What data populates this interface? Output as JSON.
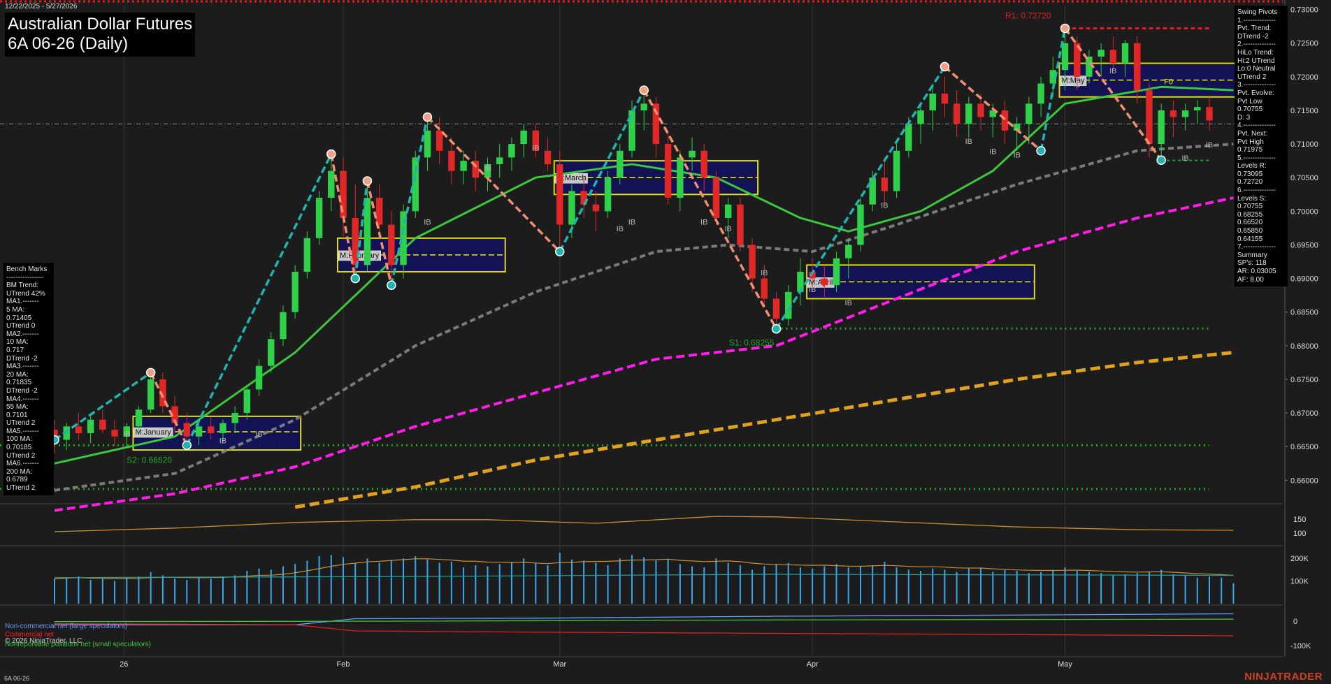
{
  "header": {
    "date_range": "12/22/2025 - 5/27/2026",
    "title": "Australian Dollar Futures",
    "subtitle": "6A 06-26 (Daily)"
  },
  "swing_panel": {
    "lines": [
      "Swing Pivots",
      "1.--------------",
      "Pvt. Trend:",
      "DTrend -2",
      "2.--------------",
      "HiLo Trend:",
      "Hi:2 UTrend",
      "Lo:0 Neutral",
      "UTrend 2",
      "3.--------------",
      "Pvt. Evolve:",
      "Pvt Low",
      "0.70755",
      "D: 3",
      "4.--------------",
      "Pvt. Next:",
      "Pvt High",
      "0.71975",
      "5.--------------",
      "Levels R:",
      "0.73095",
      "0.72720",
      "6.--------------",
      "Levels S:",
      "0.70755",
      "0.68255",
      "0.66520",
      "0.65850",
      "0.64155",
      "7.--------------",
      "Summary",
      "SP's: 118",
      "AR: 0.03005",
      "AF: 8.00"
    ]
  },
  "bench_panel": {
    "lines": [
      "Bench Marks",
      "----------------",
      "BM Trend:",
      "UTrend 42%",
      "MA1.-------",
      "5 MA:",
      "0.71405",
      "UTrend 0",
      "MA2.-------",
      "10 MA:",
      "0.717",
      "DTrend -2",
      "MA3.-------",
      "20 MA:",
      "0.71835",
      "DTrend -2",
      "MA4.-------",
      "55 MA:",
      "0.7101",
      "UTrend 2",
      "MA5.-------",
      "100 MA:",
      "0.70185",
      "UTrend 2",
      "MA6.-------",
      "200 MA:",
      "0.6789",
      "UTrend 2"
    ]
  },
  "labels": {
    "r1": "R1: 0.72720",
    "s1": "S1: 0.68255",
    "s2": "S2: 0.66520",
    "f0": "F0",
    "ib": "IB"
  },
  "months": {
    "january": "M:January",
    "february": "M:February",
    "march": "M:March",
    "april": "M:April",
    "may": "M:May"
  },
  "cot_legend": {
    "noncommercial": "Non-commercial net (large speculators)",
    "commercial": "Commercial net",
    "copyright": "© 2026 NinjaTrader, LLC",
    "nonreportable": "Nonreportable positions net (small speculators)"
  },
  "footer": {
    "instrument": "6A 06-26",
    "brand": "NINJATRADER"
  },
  "colors": {
    "background": "#1c1c1c",
    "up_candle": "#2fd04a",
    "down_candle": "#e02828",
    "swing_up": "#20b4b0",
    "swing_down": "#f09070",
    "ma_green": "#3cc83c",
    "ma_gray": "#7a7a7a",
    "ma_magenta": "#ff1ee6",
    "ma_orange": "#e0a020",
    "month_box": "#12125a",
    "month_border": "#f0f000",
    "volume": "#3aa8f0"
  },
  "chart_data": {
    "type": "candlestick",
    "title": "Australian Dollar Futures 6A 06-26 (Daily)",
    "price_axis": {
      "ylim": [
        0.6565,
        0.731
      ],
      "ticks": [
        0.66,
        0.665,
        0.67,
        0.675,
        0.68,
        0.685,
        0.69,
        0.695,
        0.7,
        0.705,
        0.71,
        0.715,
        0.72,
        0.725,
        0.73
      ]
    },
    "x_ticks": [
      {
        "label": "26",
        "i": 6
      },
      {
        "label": "Feb",
        "i": 24
      },
      {
        "label": "Mar",
        "i": 42
      },
      {
        "label": "Apr",
        "i": 63
      },
      {
        "label": "May",
        "i": 84
      }
    ],
    "candles": [
      [
        0.6675,
        0.669,
        0.664,
        0.666
      ],
      [
        0.666,
        0.6685,
        0.6645,
        0.668
      ],
      [
        0.668,
        0.67,
        0.666,
        0.667
      ],
      [
        0.667,
        0.6695,
        0.6655,
        0.669
      ],
      [
        0.669,
        0.6705,
        0.667,
        0.6675
      ],
      [
        0.6675,
        0.669,
        0.665,
        0.6665
      ],
      [
        0.6665,
        0.6685,
        0.665,
        0.668
      ],
      [
        0.668,
        0.671,
        0.667,
        0.6705
      ],
      [
        0.6705,
        0.676,
        0.67,
        0.675
      ],
      [
        0.675,
        0.676,
        0.67,
        0.671
      ],
      [
        0.671,
        0.6725,
        0.667,
        0.6685
      ],
      [
        0.6685,
        0.67,
        0.6655,
        0.6665
      ],
      [
        0.6665,
        0.669,
        0.6652,
        0.668
      ],
      [
        0.668,
        0.6695,
        0.666,
        0.667
      ],
      [
        0.667,
        0.669,
        0.6655,
        0.6685
      ],
      [
        0.6685,
        0.671,
        0.667,
        0.67
      ],
      [
        0.67,
        0.674,
        0.669,
        0.6735
      ],
      [
        0.6735,
        0.678,
        0.6725,
        0.677
      ],
      [
        0.677,
        0.682,
        0.676,
        0.681
      ],
      [
        0.681,
        0.686,
        0.68,
        0.685
      ],
      [
        0.685,
        0.692,
        0.684,
        0.691
      ],
      [
        0.691,
        0.697,
        0.69,
        0.696
      ],
      [
        0.696,
        0.703,
        0.695,
        0.702
      ],
      [
        0.702,
        0.7085,
        0.7,
        0.706
      ],
      [
        0.706,
        0.708,
        0.696,
        0.699
      ],
      [
        0.699,
        0.704,
        0.69,
        0.692
      ],
      [
        0.692,
        0.7045,
        0.691,
        0.702
      ],
      [
        0.702,
        0.704,
        0.696,
        0.698
      ],
      [
        0.698,
        0.7,
        0.689,
        0.692
      ],
      [
        0.692,
        0.701,
        0.69,
        0.7
      ],
      [
        0.7,
        0.709,
        0.699,
        0.708
      ],
      [
        0.708,
        0.7135,
        0.706,
        0.712
      ],
      [
        0.712,
        0.714,
        0.707,
        0.709
      ],
      [
        0.709,
        0.711,
        0.704,
        0.706
      ],
      [
        0.706,
        0.709,
        0.704,
        0.7075
      ],
      [
        0.7075,
        0.709,
        0.703,
        0.705
      ],
      [
        0.705,
        0.708,
        0.703,
        0.707
      ],
      [
        0.707,
        0.71,
        0.705,
        0.708
      ],
      [
        0.708,
        0.711,
        0.706,
        0.71
      ],
      [
        0.71,
        0.713,
        0.708,
        0.712
      ],
      [
        0.712,
        0.713,
        0.708,
        0.709
      ],
      [
        0.709,
        0.711,
        0.706,
        0.707
      ],
      [
        0.707,
        0.709,
        0.694,
        0.698
      ],
      [
        0.698,
        0.704,
        0.696,
        0.703
      ],
      [
        0.703,
        0.705,
        0.699,
        0.701
      ],
      [
        0.701,
        0.703,
        0.697,
        0.7
      ],
      [
        0.7,
        0.706,
        0.699,
        0.705
      ],
      [
        0.705,
        0.71,
        0.704,
        0.709
      ],
      [
        0.709,
        0.7165,
        0.708,
        0.715
      ],
      [
        0.715,
        0.718,
        0.712,
        0.716
      ],
      [
        0.716,
        0.717,
        0.708,
        0.71
      ],
      [
        0.71,
        0.712,
        0.701,
        0.702
      ],
      [
        0.702,
        0.709,
        0.7,
        0.708
      ],
      [
        0.708,
        0.711,
        0.706,
        0.709
      ],
      [
        0.709,
        0.71,
        0.703,
        0.705
      ],
      [
        0.705,
        0.706,
        0.698,
        0.699
      ],
      [
        0.699,
        0.702,
        0.696,
        0.701
      ],
      [
        0.701,
        0.702,
        0.694,
        0.695
      ],
      [
        0.695,
        0.696,
        0.688,
        0.69
      ],
      [
        0.69,
        0.692,
        0.686,
        0.687
      ],
      [
        0.687,
        0.688,
        0.6825,
        0.684
      ],
      [
        0.684,
        0.689,
        0.683,
        0.688
      ],
      [
        0.688,
        0.693,
        0.686,
        0.691
      ],
      [
        0.691,
        0.693,
        0.688,
        0.69
      ],
      [
        0.69,
        0.692,
        0.687,
        0.689
      ],
      [
        0.689,
        0.694,
        0.688,
        0.693
      ],
      [
        0.693,
        0.696,
        0.69,
        0.695
      ],
      [
        0.695,
        0.702,
        0.694,
        0.701
      ],
      [
        0.701,
        0.706,
        0.7,
        0.705
      ],
      [
        0.705,
        0.708,
        0.701,
        0.703
      ],
      [
        0.703,
        0.71,
        0.702,
        0.709
      ],
      [
        0.709,
        0.714,
        0.708,
        0.713
      ],
      [
        0.713,
        0.716,
        0.71,
        0.715
      ],
      [
        0.715,
        0.719,
        0.712,
        0.7175
      ],
      [
        0.7175,
        0.72,
        0.714,
        0.716
      ],
      [
        0.716,
        0.718,
        0.711,
        0.713
      ],
      [
        0.713,
        0.717,
        0.711,
        0.716
      ],
      [
        0.716,
        0.7175,
        0.712,
        0.714
      ],
      [
        0.714,
        0.716,
        0.711,
        0.715
      ],
      [
        0.715,
        0.7165,
        0.71,
        0.712
      ],
      [
        0.712,
        0.714,
        0.709,
        0.713
      ],
      [
        0.713,
        0.717,
        0.71,
        0.716
      ],
      [
        0.716,
        0.72,
        0.714,
        0.719
      ],
      [
        0.719,
        0.723,
        0.717,
        0.721
      ],
      [
        0.721,
        0.7272,
        0.718,
        0.725
      ],
      [
        0.725,
        0.726,
        0.718,
        0.72
      ],
      [
        0.72,
        0.724,
        0.719,
        0.723
      ],
      [
        0.723,
        0.725,
        0.72,
        0.724
      ],
      [
        0.724,
        0.726,
        0.721,
        0.722
      ],
      [
        0.722,
        0.7255,
        0.72,
        0.725
      ],
      [
        0.725,
        0.726,
        0.716,
        0.718
      ],
      [
        0.718,
        0.719,
        0.708,
        0.71
      ],
      [
        0.71,
        0.716,
        0.7076,
        0.715
      ],
      [
        0.715,
        0.7165,
        0.711,
        0.714
      ],
      [
        0.714,
        0.716,
        0.712,
        0.715
      ],
      [
        0.715,
        0.7165,
        0.713,
        0.7155
      ],
      [
        0.7155,
        0.717,
        0.712,
        0.7135
      ]
    ],
    "swing_pivots": [
      {
        "i": 0,
        "price": 0.666
      },
      {
        "i": 8,
        "price": 0.676
      },
      {
        "i": 11,
        "price": 0.6652
      },
      {
        "i": 23,
        "price": 0.7085
      },
      {
        "i": 25,
        "price": 0.69
      },
      {
        "i": 26,
        "price": 0.7045
      },
      {
        "i": 28,
        "price": 0.689
      },
      {
        "i": 31,
        "price": 0.714
      },
      {
        "i": 42,
        "price": 0.694
      },
      {
        "i": 49,
        "price": 0.718
      },
      {
        "i": 60,
        "price": 0.6825
      },
      {
        "i": 74,
        "price": 0.7215
      },
      {
        "i": 82,
        "price": 0.709
      },
      {
        "i": 84,
        "price": 0.7272
      },
      {
        "i": 92,
        "price": 0.7076
      }
    ],
    "levels": [
      {
        "name": "R1",
        "price": 0.7272
      },
      {
        "name": "S1",
        "price": 0.68255
      },
      {
        "name": "S2",
        "price": 0.6652
      },
      {
        "name": "S",
        "price": 0.6587
      },
      {
        "name": "Pvt Low",
        "price": 0.70755
      }
    ],
    "current_price_line": 0.713,
    "month_boxes": [
      {
        "label": "M:January",
        "i0": 7,
        "i1": 20,
        "top": 0.6695,
        "bottom": 0.6645,
        "mid": 0.6672
      },
      {
        "label": "M:February",
        "i0": 24,
        "i1": 37,
        "top": 0.696,
        "bottom": 0.691,
        "mid": 0.6935
      },
      {
        "label": "M:March",
        "i0": 42,
        "i1": 58,
        "top": 0.7075,
        "bottom": 0.7025,
        "mid": 0.705
      },
      {
        "label": "M:April",
        "i0": 63,
        "i1": 81,
        "top": 0.692,
        "bottom": 0.687,
        "mid": 0.6895
      },
      {
        "label": "M:May",
        "i0": 84,
        "i1": 98,
        "top": 0.722,
        "bottom": 0.717,
        "mid": 0.7195
      }
    ],
    "moving_averages": [
      {
        "name": "20 MA",
        "color": "green",
        "points": [
          [
            0,
            0.6625
          ],
          [
            10,
            0.6665
          ],
          [
            20,
            0.679
          ],
          [
            30,
            0.696
          ],
          [
            40,
            0.705
          ],
          [
            48,
            0.707
          ],
          [
            55,
            0.705
          ],
          [
            62,
            0.699
          ],
          [
            66,
            0.697
          ],
          [
            72,
            0.7
          ],
          [
            78,
            0.706
          ],
          [
            84,
            0.716
          ],
          [
            92,
            0.7185
          ],
          [
            98,
            0.718
          ]
        ]
      },
      {
        "name": "55 MA",
        "color": "gray",
        "points": [
          [
            0,
            0.6585
          ],
          [
            10,
            0.661
          ],
          [
            20,
            0.669
          ],
          [
            30,
            0.68
          ],
          [
            40,
            0.688
          ],
          [
            50,
            0.694
          ],
          [
            56,
            0.695
          ],
          [
            63,
            0.694
          ],
          [
            70,
            0.698
          ],
          [
            80,
            0.704
          ],
          [
            90,
            0.709
          ],
          [
            98,
            0.71
          ]
        ]
      },
      {
        "name": "100 MA",
        "color": "magenta",
        "points": [
          [
            0,
            0.6555
          ],
          [
            10,
            0.658
          ],
          [
            20,
            0.662
          ],
          [
            30,
            0.668
          ],
          [
            40,
            0.673
          ],
          [
            50,
            0.678
          ],
          [
            60,
            0.68
          ],
          [
            70,
            0.687
          ],
          [
            80,
            0.694
          ],
          [
            90,
            0.699
          ],
          [
            98,
            0.702
          ]
        ]
      },
      {
        "name": "200 MA",
        "color": "orange",
        "points": [
          [
            20,
            0.656
          ],
          [
            30,
            0.659
          ],
          [
            40,
            0.663
          ],
          [
            50,
            0.666
          ],
          [
            60,
            0.669
          ],
          [
            70,
            0.672
          ],
          [
            80,
            0.675
          ],
          [
            90,
            0.6775
          ],
          [
            98,
            0.679
          ]
        ]
      }
    ],
    "panel2": {
      "name": "indicator",
      "ticks": [
        100,
        150
      ],
      "ylim": [
        60,
        200
      ],
      "points": [
        [
          0,
          105
        ],
        [
          10,
          118
        ],
        [
          20,
          138
        ],
        [
          30,
          148
        ],
        [
          36,
          148
        ],
        [
          45,
          135
        ],
        [
          55,
          160
        ],
        [
          60,
          158
        ],
        [
          70,
          140
        ],
        [
          80,
          122
        ],
        [
          90,
          112
        ],
        [
          98,
          110
        ]
      ]
    },
    "volume": {
      "ticks": [
        "100K",
        "200K"
      ],
      "ylim": [
        0,
        250000
      ],
      "values": [
        110000,
        115000,
        120000,
        105000,
        110000,
        100000,
        115000,
        120000,
        140000,
        125000,
        110000,
        105000,
        115000,
        110000,
        120000,
        125000,
        145000,
        155000,
        150000,
        165000,
        175000,
        190000,
        210000,
        215000,
        205000,
        180000,
        200000,
        180000,
        190000,
        200000,
        210000,
        195000,
        180000,
        185000,
        160000,
        170000,
        165000,
        175000,
        185000,
        200000,
        180000,
        170000,
        225000,
        195000,
        190000,
        180000,
        170000,
        200000,
        215000,
        205000,
        190000,
        195000,
        175000,
        165000,
        160000,
        200000,
        180000,
        170000,
        150000,
        165000,
        175000,
        180000,
        160000,
        155000,
        165000,
        175000,
        160000,
        165000,
        170000,
        185000,
        160000,
        150000,
        145000,
        155000,
        150000,
        140000,
        155000,
        160000,
        140000,
        150000,
        145000,
        135000,
        140000,
        150000,
        160000,
        145000,
        140000,
        135000,
        125000,
        130000,
        135000,
        140000,
        150000,
        130000,
        125000,
        115000,
        120000,
        115000,
        90000
      ]
    },
    "cot": {
      "ticks": [
        "0",
        "-100K"
      ],
      "ylim": [
        -140000,
        60000
      ],
      "noncommercial": [
        [
          0,
          -15000
        ],
        [
          20,
          -15000
        ],
        [
          25,
          10000
        ],
        [
          40,
          12000
        ],
        [
          60,
          20000
        ],
        [
          80,
          25000
        ],
        [
          98,
          30000
        ]
      ],
      "nonreportable": [
        [
          0,
          -2000
        ],
        [
          30,
          0
        ],
        [
          60,
          5000
        ],
        [
          98,
          8000
        ]
      ],
      "commercial": [
        [
          0,
          -10000
        ],
        [
          20,
          -15000
        ],
        [
          25,
          -40000
        ],
        [
          40,
          -45000
        ],
        [
          60,
          -50000
        ],
        [
          80,
          -55000
        ],
        [
          98,
          -60000
        ]
      ]
    }
  }
}
